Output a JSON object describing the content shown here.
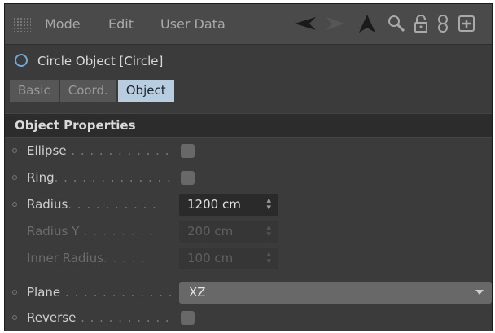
{
  "menubar": {
    "items": [
      "Mode",
      "Edit",
      "User Data"
    ],
    "tools": [
      "back-arrow-icon",
      "forward-arrow-icon",
      "up-arrow-icon",
      "search-icon",
      "lock-icon",
      "link-icon",
      "new-window-icon"
    ]
  },
  "object": {
    "title": "Circle Object [Circle]"
  },
  "tabs": [
    {
      "label": "Basic",
      "active": false
    },
    {
      "label": "Coord.",
      "active": false
    },
    {
      "label": "Object",
      "active": true
    }
  ],
  "section": {
    "title": "Object Properties"
  },
  "properties": [
    {
      "label": "Ellipse",
      "dots": " . . . . . . . . . . . ",
      "type": "checkbox",
      "checked": false,
      "enabled": true
    },
    {
      "label": "Ring",
      "dots": ". . . . . . . . . . . . . ",
      "type": "checkbox",
      "checked": false,
      "enabled": true
    },
    {
      "label": "Radius",
      "dots": ". . . . . . . . . . ",
      "type": "number",
      "value": "1200 cm",
      "enabled": true
    },
    {
      "label": "Radius Y",
      "dots": " . . . . . . . . ",
      "type": "number",
      "value": "200 cm",
      "enabled": false
    },
    {
      "label": "Inner Radius",
      "dots": ". . . . . ",
      "type": "number",
      "value": "100 cm",
      "enabled": false
    },
    {
      "label": "Plane",
      "dots": " . . . . . . . . . . . . ",
      "type": "dropdown",
      "value": "XZ",
      "enabled": true
    },
    {
      "label": "Reverse",
      "dots": " . . . . . . . . . . ",
      "type": "checkbox",
      "checked": false,
      "enabled": true
    }
  ],
  "colors": {
    "panel_bg": "#3b3b3b",
    "menubar_bg": "#4a4a4a",
    "active_tab": "#b8cde0",
    "circle_icon": "#6ea9d8"
  }
}
